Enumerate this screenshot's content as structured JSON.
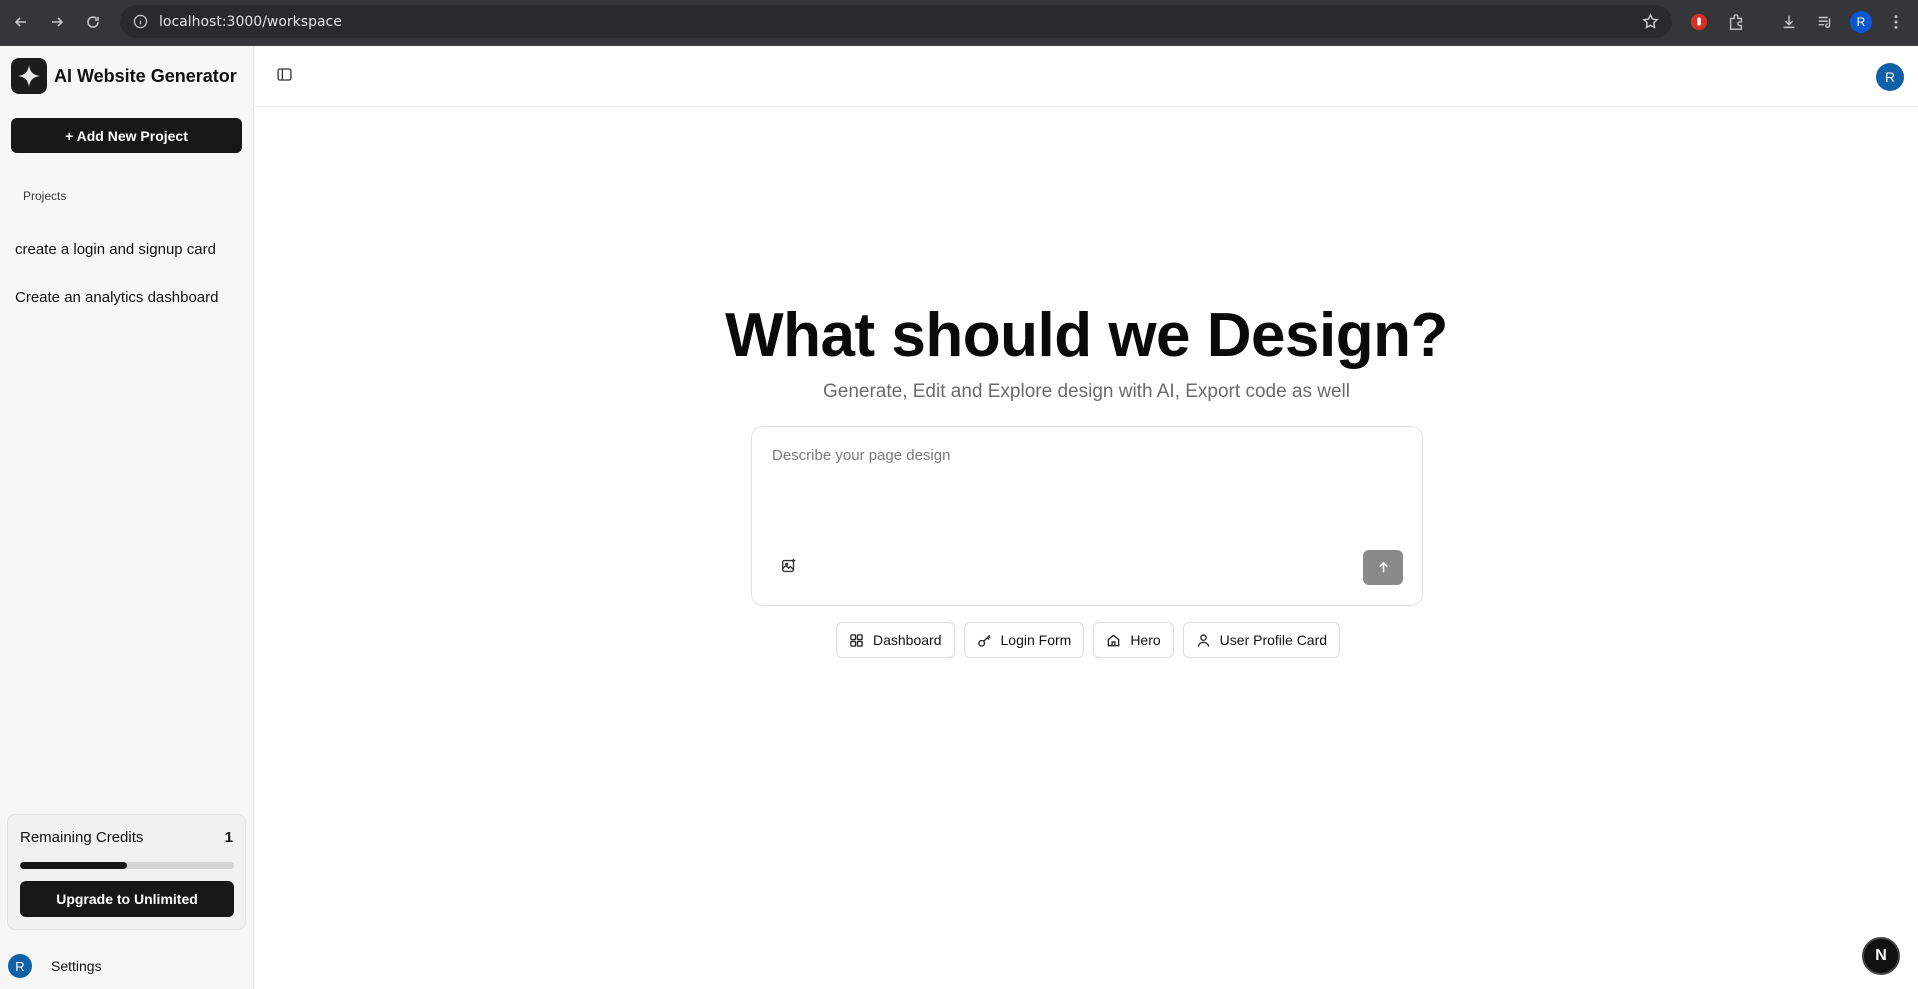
{
  "browser": {
    "url": "localhost:3000/workspace",
    "profile_initial": "R"
  },
  "sidebar": {
    "brand_title": "AI Website Generator",
    "add_project_label": "+ Add New Project",
    "projects_heading": "Projects",
    "projects": [
      {
        "label": "create a login and signup card"
      },
      {
        "label": "Create an analytics dashboard"
      }
    ],
    "credits": {
      "label": "Remaining Credits",
      "value": "1",
      "progress_fraction": 0.5
    },
    "upgrade_label": "Upgrade to Unlimited",
    "settings_label": "Settings",
    "avatar_initial": "R"
  },
  "header": {
    "avatar_initial": "R"
  },
  "main": {
    "title": "What should we Design?",
    "subtitle": "Generate, Edit and Explore design with AI, Export code as well",
    "prompt_placeholder": "Describe your page design",
    "suggestions": [
      {
        "label": "Dashboard",
        "icon": "grid-icon"
      },
      {
        "label": "Login Form",
        "icon": "key-icon"
      },
      {
        "label": "Hero",
        "icon": "home-icon"
      },
      {
        "label": "User Profile Card",
        "icon": "user-icon"
      }
    ]
  },
  "dev_badge": "N",
  "colors": {
    "primary": "#171717",
    "avatar": "#1060a8",
    "send_button": "#8a8a8a"
  }
}
